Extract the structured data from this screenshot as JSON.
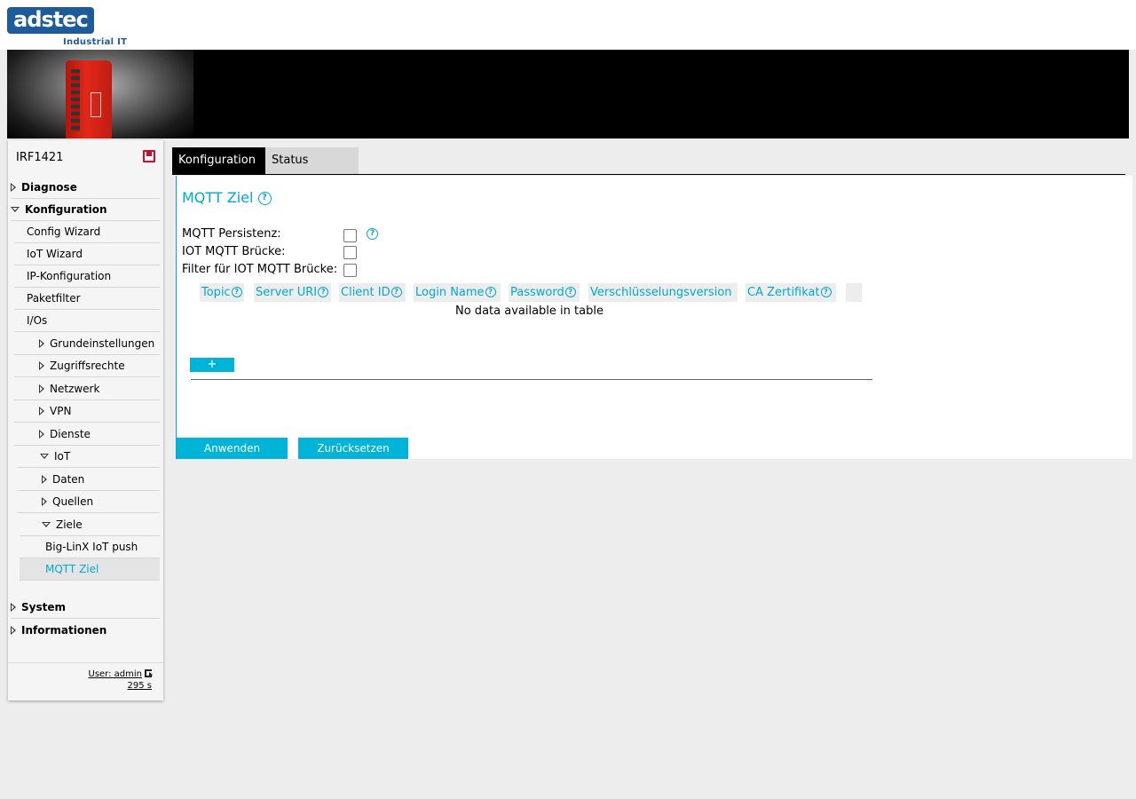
{
  "brand": {
    "logo": "adstec",
    "sub": "Industrial IT"
  },
  "sidebar": {
    "device_name": "IRF1421",
    "items": [
      {
        "label": "Diagnose"
      },
      {
        "label": "Konfiguration"
      },
      {
        "label": "Config Wizard"
      },
      {
        "label": "IoT Wizard"
      },
      {
        "label": "IP-Konfiguration"
      },
      {
        "label": "Paketfilter"
      },
      {
        "label": "I/Os"
      },
      {
        "label": "Grundeinstellungen"
      },
      {
        "label": "Zugriffsrechte"
      },
      {
        "label": "Netzwerk"
      },
      {
        "label": "VPN"
      },
      {
        "label": "Dienste"
      },
      {
        "label": "IoT"
      },
      {
        "label": "Daten"
      },
      {
        "label": "Quellen"
      },
      {
        "label": "Ziele"
      },
      {
        "label": "Big-LinX IoT push"
      },
      {
        "label": "MQTT Ziel"
      },
      {
        "label": "System"
      },
      {
        "label": "Informationen"
      }
    ],
    "user": "User: admin",
    "timer": "295 s"
  },
  "tabs": [
    {
      "label": "Konfiguration"
    },
    {
      "label": "Status"
    }
  ],
  "panel": {
    "title": "MQTT Ziel",
    "fields": [
      {
        "label": "MQTT Persistenz:",
        "checked": false
      },
      {
        "label": "IOT MQTT Brücke:",
        "checked": false
      },
      {
        "label": "Filter für IOT MQTT Brücke:",
        "checked": false
      }
    ],
    "table": {
      "columns": [
        "Topic",
        "Server URI",
        "Client ID",
        "Login Name",
        "Password",
        "Verschlüsselungsversion",
        "CA Zertifikat"
      ],
      "empty_text": "No data available in table",
      "add_label": "+"
    },
    "apply_label": "Anwenden",
    "reset_label": "Zurücksetzen"
  },
  "colors": {
    "accent": "#00a9d4",
    "button": "#00b4d8",
    "brand": "#1d5b9a"
  }
}
